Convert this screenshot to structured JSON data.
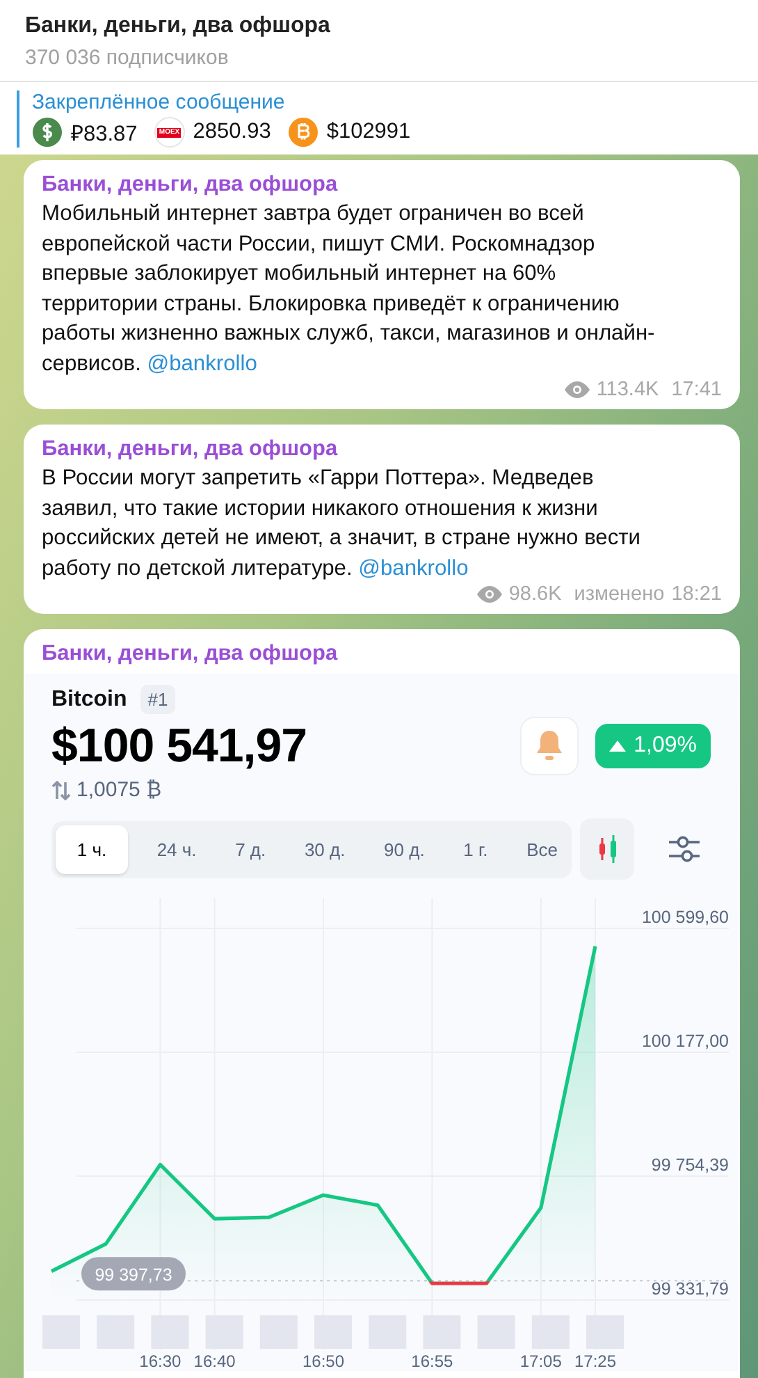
{
  "header": {
    "title": "Банки, деньги, два офшора",
    "subtitle": "370 036 подписчиков"
  },
  "pinned": {
    "label": "Закреплённое сообщение",
    "items": [
      {
        "kind": "dollar",
        "value": "₽83.87"
      },
      {
        "kind": "moex",
        "logo_text": "MOEX",
        "value": "2850.93"
      },
      {
        "kind": "bitcoin",
        "value": "$102991"
      }
    ]
  },
  "messages": [
    {
      "kind": "text",
      "author": "Банки, деньги, два офшора",
      "text": "Мобильный интернет завтра будет ограничен во всей европейской части России, пишут СМИ. Роскомнадзор впервые заблокирует мобильный интернет на 60% территории страны. Блокировка приведёт к ограничению работы жизненно важных служб, такси, магазинов и онлайн-сервисов.",
      "link": "@bankrollo",
      "views": "113.4K",
      "time": "17:41"
    },
    {
      "kind": "text",
      "author": "Банки, деньги, два офшора",
      "text": "В России могут запретить «Гарри Поттера». Медведев заявил, что такие истории никакого отношения к жизни российских детей не имеют, а значит, в стране нужно вести работу по детской литературе.",
      "link": "@bankrollo",
      "views": "98.6K",
      "edited_label": "изменено",
      "time": "18:21"
    },
    {
      "kind": "screenshot",
      "author": "Банки, деньги, два офшора",
      "coin": {
        "name": "Bitcoin",
        "rank": "#1",
        "price": "$100 541,97",
        "change": "1,09%",
        "rising": true,
        "volume": "1,0075 ₿",
        "periods": [
          {
            "label": "1 ч.",
            "selected": true
          },
          {
            "label": "24 ч.",
            "selected": false
          },
          {
            "label": "7 д.",
            "selected": false
          },
          {
            "label": "30 д.",
            "selected": false
          },
          {
            "label": "90 д.",
            "selected": false
          },
          {
            "label": "1 г.",
            "selected": false
          },
          {
            "label": "Все",
            "selected": false
          }
        ],
        "chart_data": {
          "type": "area",
          "categories": [
            null,
            null,
            "16:30",
            "16:40",
            null,
            "16:50",
            null,
            "16:55",
            null,
            "17:05",
            "17:25"
          ],
          "series": [
            {
              "color": "#16c784",
              "values": [
                99430,
                99523,
                99794,
                99609,
                99614,
                99690,
                99655,
                99389,
                99389,
                99646,
                100539
              ]
            }
          ],
          "ylim": [
            99331.79,
            100599.6
          ],
          "yticks": [
            {
              "value": 100599.6,
              "label": "100 599,60"
            },
            {
              "value": 100177,
              "label": "100 177,00"
            },
            {
              "value": 99754.39,
              "label": "99 754,39"
            },
            {
              "value": 99331.79,
              "label": "99 331,79"
            }
          ],
          "grid": true,
          "ref_lines": [
            {
              "axis": "y",
              "value": 99397.73,
              "label": "99 397,73"
            }
          ]
        }
      }
    }
  ]
}
